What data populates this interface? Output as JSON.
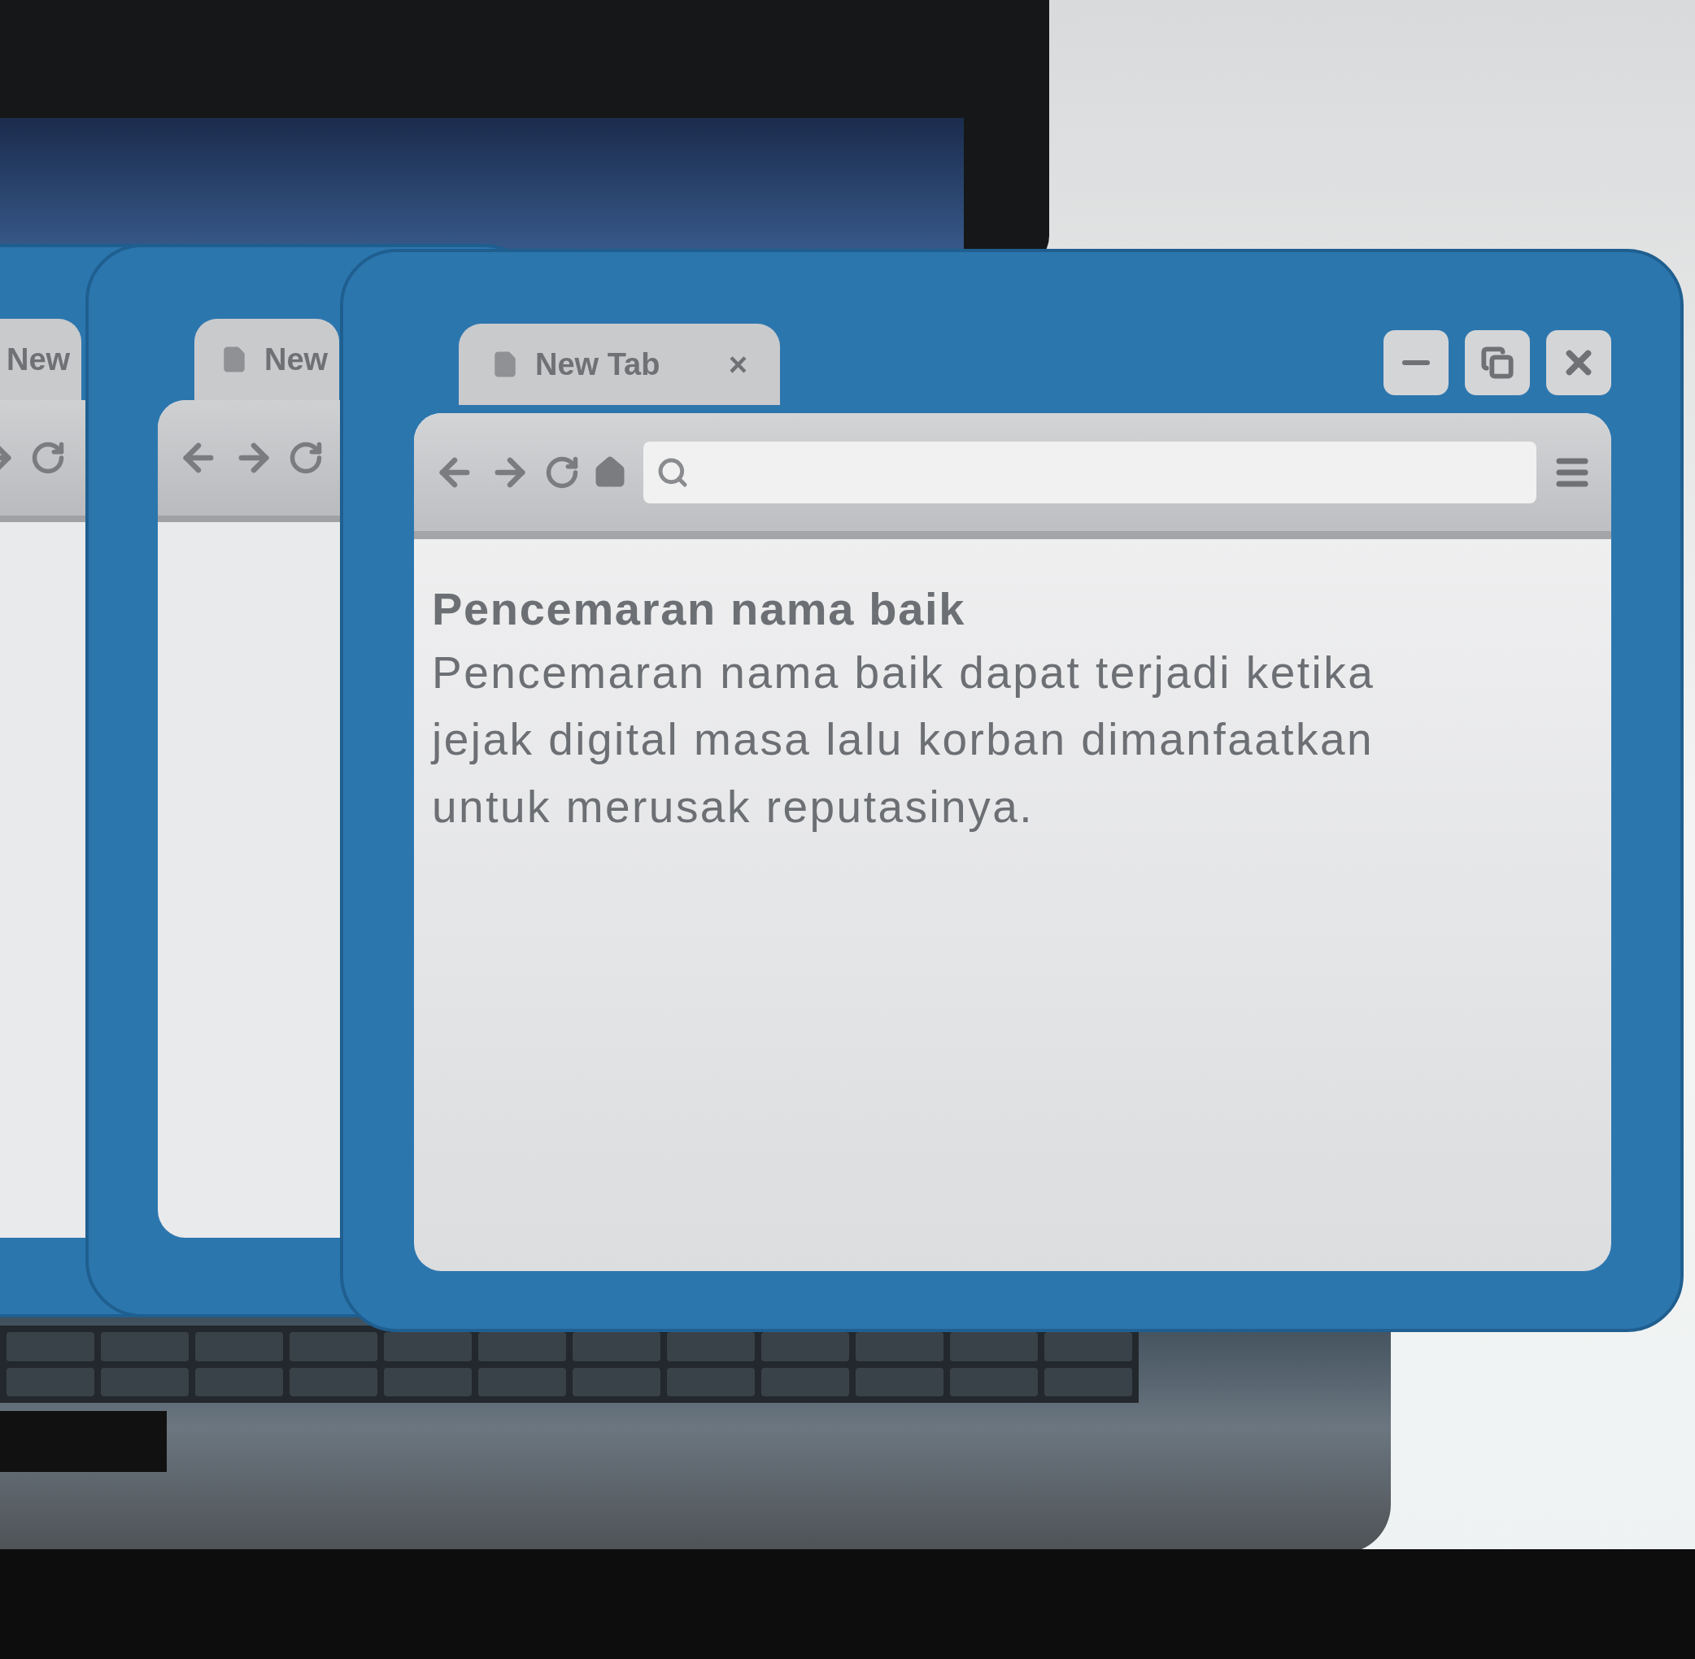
{
  "back_windows": [
    {
      "tab": {
        "label": "New"
      }
    },
    {
      "tab": {
        "label": "New"
      }
    }
  ],
  "front_window": {
    "tab": {
      "label": "New Tab",
      "close": "×"
    },
    "page": {
      "heading": "Pencemaran nama baik",
      "body": "Pencemaran nama baik dapat terjadi ketika jejak digital masa lalu korban dimanfaatkan untuk merusak reputasinya."
    }
  }
}
